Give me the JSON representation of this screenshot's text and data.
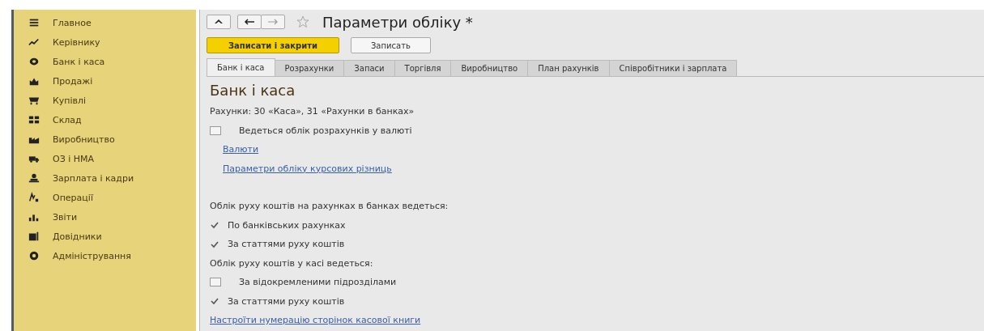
{
  "sidebar": {
    "items": [
      {
        "label": "Главное"
      },
      {
        "label": "Керівнику"
      },
      {
        "label": "Банк і каса"
      },
      {
        "label": "Продажі"
      },
      {
        "label": "Купівлі"
      },
      {
        "label": "Склад"
      },
      {
        "label": "Виробництво"
      },
      {
        "label": "ОЗ і НМА"
      },
      {
        "label": "Зарплата і кадри"
      },
      {
        "label": "Операції"
      },
      {
        "label": "Звіти"
      },
      {
        "label": "Довідники"
      },
      {
        "label": "Адміністрування"
      }
    ]
  },
  "window": {
    "title": "Параметри обліку *"
  },
  "toolbar": {
    "buttons": [
      {
        "label": "Записати і закрити",
        "kind": "primary"
      },
      {
        "label": "Записать",
        "kind": "plain"
      }
    ]
  },
  "tabs": [
    {
      "label": "Банк і каса",
      "selected": true
    },
    {
      "label": "Розрахунки",
      "selected": false
    },
    {
      "label": "Запаси",
      "selected": false
    },
    {
      "label": "Торгівля",
      "selected": false
    },
    {
      "label": "Виробництво",
      "selected": false
    },
    {
      "label": "План рахунків",
      "selected": false
    },
    {
      "label": "Співробітники і зарплата",
      "selected": false
    }
  ],
  "section": {
    "heading": "Банк і каса",
    "rows": [
      {
        "kind": "note",
        "text": "Рахунки: 30 «Каса», 31 «Рахунки в банках»"
      },
      {
        "kind": "checkbox",
        "text": "Ведеться облік розрахунків у валюті",
        "checked": false
      },
      {
        "kind": "sublink",
        "text": "Валюти"
      },
      {
        "kind": "sublink",
        "text": "Параметри обліку курсових різниць"
      },
      {
        "kind": "gap"
      },
      {
        "kind": "label",
        "text": "Облік руху коштів на рахунках в банках ведеться:"
      },
      {
        "kind": "checkbox",
        "text": "По банківських рахунках",
        "checked": true
      },
      {
        "kind": "checkbox",
        "text": "За статтями руху коштів",
        "checked": true
      },
      {
        "kind": "label",
        "text": "Облік руху коштів у касі ведеться:"
      },
      {
        "kind": "checkbox",
        "text": "За відокремленими підрозділами",
        "checked": false
      },
      {
        "kind": "checkbox",
        "text": "За статтями руху коштів",
        "checked": true
      },
      {
        "kind": "link",
        "text": "Настроїти нумерацію сторінок касової книги"
      }
    ]
  }
}
